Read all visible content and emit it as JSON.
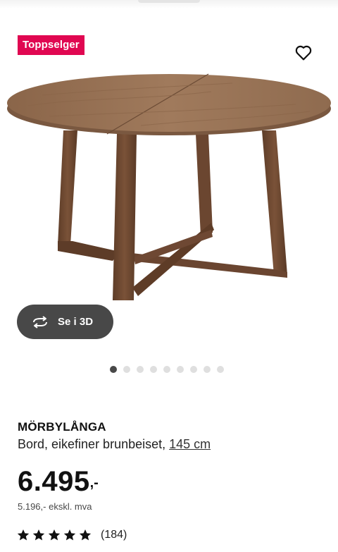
{
  "badge": {
    "label": "Toppselger",
    "color": "#e00751"
  },
  "favorite": {
    "icon": "heart-outline-icon"
  },
  "view3d": {
    "label": "Se i 3D",
    "icon": "rotate-3d-icon"
  },
  "carousel": {
    "total": 9,
    "active_index": 0
  },
  "product": {
    "name": "MÖRBYLÅNGA",
    "description": "Bord, eikefiner brunbeiset, ",
    "size_link": "145 cm",
    "price_main": "6.495",
    "price_decimal": ",-",
    "price_ex_vat": "5.196,- ekskl. mva",
    "rating_stars": 5,
    "rating_count": "(184)"
  }
}
